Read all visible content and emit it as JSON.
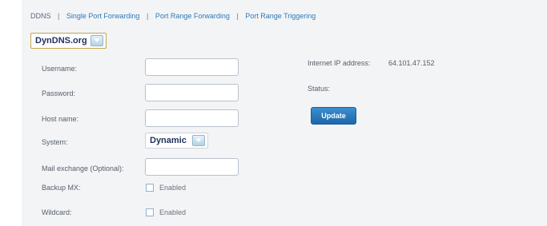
{
  "tabs": [
    {
      "label": "DDNS"
    },
    {
      "label": "Single Port Forwarding"
    },
    {
      "label": "Port Range Forwarding"
    },
    {
      "label": "Port Range Triggering"
    }
  ],
  "tab_separator": "|",
  "ddns_provider": {
    "selected": "DynDNS.org"
  },
  "form": {
    "username_label": "Username:",
    "username_value": "",
    "password_label": "Password:",
    "password_value": "",
    "hostname_label": "Host name:",
    "hostname_value": "",
    "system_label": "System:",
    "system_selected": "Dynamic",
    "mail_exchange_label": "Mail exchange (Optional):",
    "mail_exchange_value": "",
    "backup_mx_label": "Backup MX:",
    "backup_mx_option": "Enabled",
    "backup_mx_checked": false,
    "wildcard_label": "Wildcard:",
    "wildcard_option": "Enabled",
    "wildcard_checked": false
  },
  "info": {
    "ip_label": "Internet IP address:",
    "ip_value": "64.101.47.152",
    "status_label": "Status:",
    "status_value": "",
    "update_button": "Update"
  },
  "colors": {
    "panel_bg": "#f3f4f6",
    "link": "#2f79b6",
    "button": "#2274b8",
    "select_border": "#c3a24a"
  }
}
